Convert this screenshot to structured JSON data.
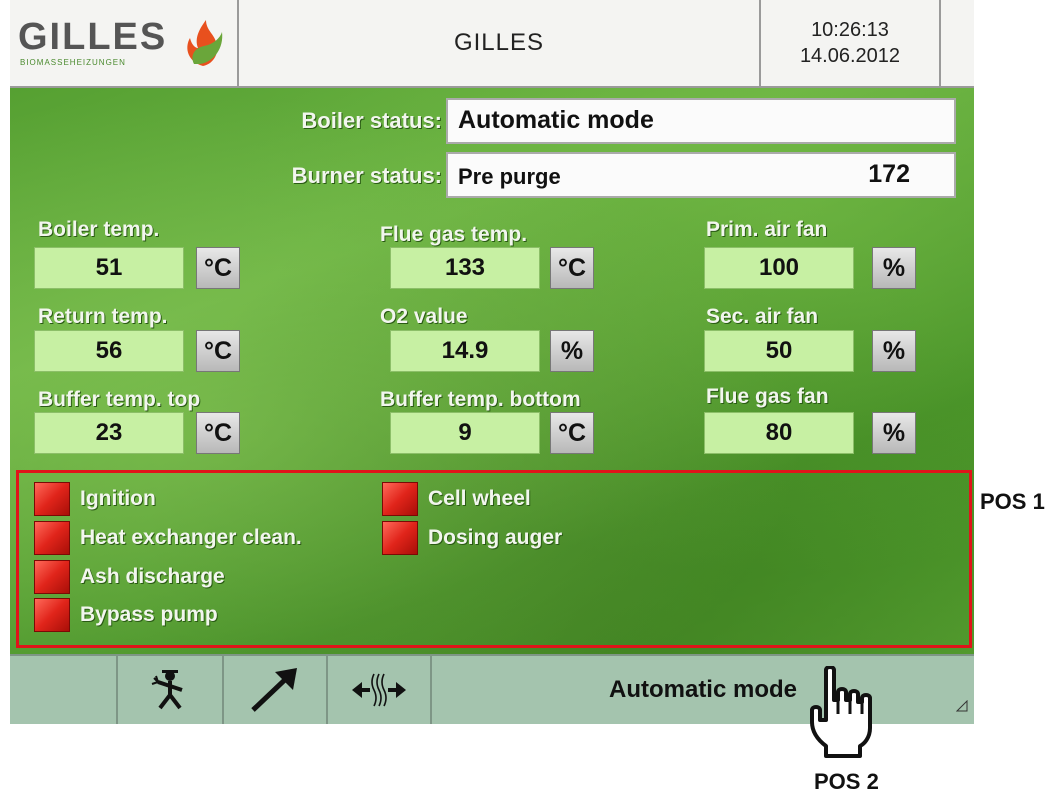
{
  "header": {
    "logo_text": "GILLES",
    "logo_subtext": "BIOMASSEHEIZUNGEN",
    "title": "GILLES",
    "time": "10:26:13",
    "date": "14.06.2012"
  },
  "status": {
    "boiler_label": "Boiler status:",
    "boiler_value": "Automatic mode",
    "burner_label": "Burner status:",
    "burner_value": "Pre purge",
    "burner_number": "172"
  },
  "params": {
    "boiler_temp": {
      "label": "Boiler temp.",
      "value": "51",
      "unit": "°C"
    },
    "return_temp": {
      "label": "Return temp.",
      "value": "56",
      "unit": "°C"
    },
    "buffer_top": {
      "label": "Buffer temp. top",
      "value": "23",
      "unit": "°C"
    },
    "flue_gas_temp": {
      "label": "Flue gas temp.",
      "value": "133",
      "unit": "°C"
    },
    "o2_value": {
      "label": "O2 value",
      "value": "14.9",
      "unit": "%"
    },
    "buffer_bottom": {
      "label": "Buffer temp. bottom",
      "value": "9",
      "unit": "°C"
    },
    "prim_air_fan": {
      "label": "Prim. air fan",
      "value": "100",
      "unit": "%"
    },
    "sec_air_fan": {
      "label": "Sec. air fan",
      "value": "50",
      "unit": "%"
    },
    "flue_gas_fan": {
      "label": "Flue gas fan",
      "value": "80",
      "unit": "%"
    }
  },
  "indicators": {
    "ignition": "Ignition",
    "heat_exchanger": "Heat exchanger clean.",
    "ash_discharge": "Ash discharge",
    "bypass_pump": "Bypass pump",
    "cell_wheel": "Cell wheel",
    "dosing_auger": "Dosing auger"
  },
  "footer": {
    "mode_button": "Automatic mode",
    "icons": [
      "chimney-sweep-icon",
      "arrow-icon",
      "heat-exchange-icon"
    ]
  },
  "annotations": {
    "pos1": "POS 1",
    "pos2": "POS 2"
  },
  "colors": {
    "led_active": "#e0241a",
    "value_field": "#c7f0a3",
    "frame": "#e0141a",
    "footer": "#a4c4ae"
  }
}
